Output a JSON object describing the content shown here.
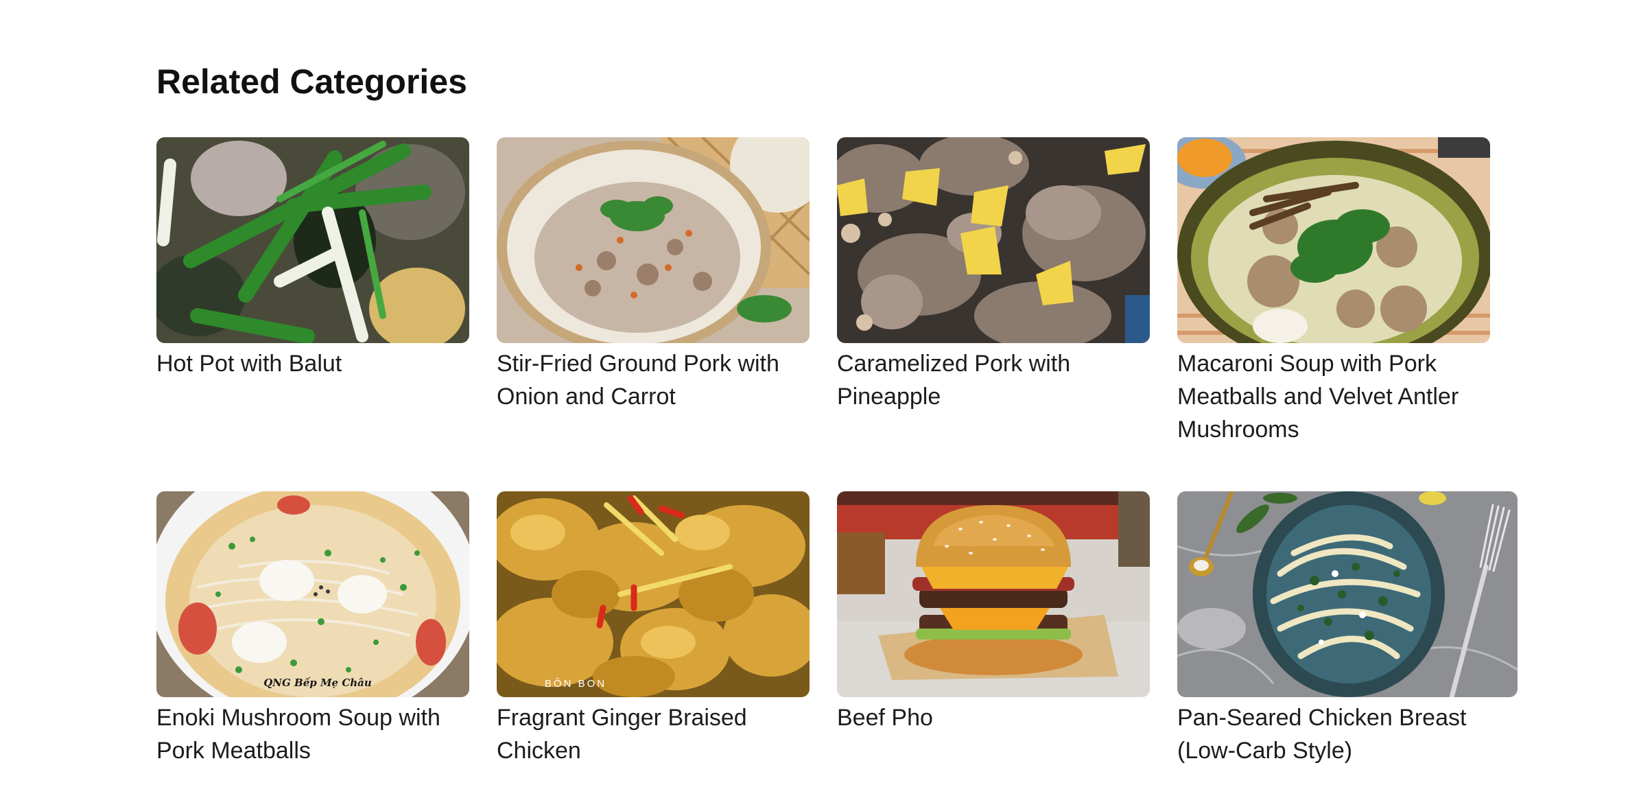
{
  "section": {
    "heading": "Related Categories"
  },
  "categories": [
    {
      "title": "Hot Pot with Balut",
      "image_icon": "hot-pot-balut-photo"
    },
    {
      "title": "Stir-Fried Ground Pork with Onion and Carrot",
      "image_icon": "stir-fried-pork-photo"
    },
    {
      "title": "Caramelized Pork with Pineapple",
      "image_icon": "caramelized-pork-photo"
    },
    {
      "title": "Macaroni Soup with Pork Meatballs and Velvet Antler Mushrooms",
      "image_icon": "macaroni-soup-photo"
    },
    {
      "title": "Enoki Mushroom Soup with Pork Meatballs",
      "image_icon": "enoki-soup-photo",
      "watermark": "QNG Bếp Mẹ Châu"
    },
    {
      "title": "Fragrant Ginger Braised Chicken",
      "image_icon": "ginger-chicken-photo",
      "watermark": "BÔN BON"
    },
    {
      "title": "Beef Pho",
      "image_icon": "burger-photo"
    },
    {
      "title": "Pan-Seared Chicken Breast (Low-Carb Style)",
      "image_icon": "pasta-plate-photo"
    }
  ]
}
